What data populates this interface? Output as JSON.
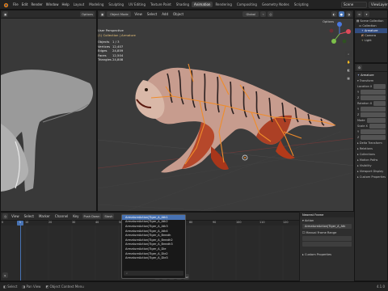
{
  "menu": {
    "items": [
      "File",
      "Edit",
      "Render",
      "Window",
      "Help"
    ],
    "workspaces": [
      "Layout",
      "Modeling",
      "Sculpting",
      "UV Editing",
      "Texture Paint",
      "Shading",
      "Animation",
      "Rendering",
      "Compositing",
      "Geometry Nodes",
      "Scripting"
    ],
    "active_workspace": "Animation",
    "scene": "Scene",
    "view_layer": "ViewLayer"
  },
  "left_viewport": {
    "options_label": "Options"
  },
  "main_viewport": {
    "mode": "Object Mode",
    "menus": [
      "View",
      "Select",
      "Add",
      "Object"
    ],
    "transform": "Global",
    "options_label": "Options",
    "view_name": "User Perspective",
    "collection_info": "(1) Collection | Armature",
    "stats": [
      {
        "k": "Objects",
        "v": "1 / 3"
      },
      {
        "k": "Vertices",
        "v": "12,407"
      },
      {
        "k": "Edges",
        "v": "24,859"
      },
      {
        "k": "Faces",
        "v": "12,504"
      },
      {
        "k": "Triangles",
        "v": "24,808"
      }
    ]
  },
  "outliner": {
    "rows": [
      "Scene Collection",
      "Collection",
      "Armature",
      "Camera",
      "Light"
    ]
  },
  "properties": {
    "object_name": "Armature",
    "sections": [
      "Transform",
      "Location X",
      "Y",
      "Z",
      "Rotation X",
      "Y",
      "Z",
      "Mode",
      "Scale X",
      "Y",
      "Z",
      "Delta Transform",
      "Relations",
      "Collections",
      "Motion Paths",
      "Visibility",
      "Viewport Display",
      "Custom Properties"
    ]
  },
  "timeline": {
    "menus": [
      "View",
      "Select",
      "Marker",
      "Channel",
      "Key"
    ],
    "push_down": "Push Down",
    "stash": "Stash",
    "ticks": [
      "0",
      "10",
      "20",
      "30",
      "40",
      "50",
      "60",
      "70",
      "80",
      "90",
      "100",
      "110",
      "120"
    ],
    "current_frame": "1"
  },
  "action_dropdown": {
    "items": [
      "ArmatureAction|Tiger_A_Atk1",
      "ArmatureAction|Tiger_A_Atk2",
      "ArmatureAction|Tiger_A_Atk3",
      "ArmatureAction|Tiger_A_Atk4",
      "ArmatureAction|Tiger_A_Breath",
      "ArmatureAction|Tiger_A_Breath2",
      "ArmatureAction|Tiger_A_Breath3",
      "ArmatureAction|Tiger_A_Die",
      "ArmatureAction|Tiger_A_Die2",
      "ArmatureAction|Tiger_A_Die3"
    ],
    "highlighted": 0,
    "search_label": "Search"
  },
  "nla_sidebar": {
    "title": "Nearest Frame",
    "action_label": "Action",
    "action_value": "ArmatureAction|Tiger_A_Atk",
    "manual_frame_range": "Manual Frame Range",
    "custom_properties": "Custom Properties"
  },
  "statusbar": {
    "items": [
      "Select",
      "Pan View",
      "Object Context Menu"
    ],
    "version": "4.1.0"
  },
  "colors": {
    "accent_blue": "#4772b3",
    "bone_orange": "#f08c2a",
    "selection_red": "#b33a1a"
  }
}
